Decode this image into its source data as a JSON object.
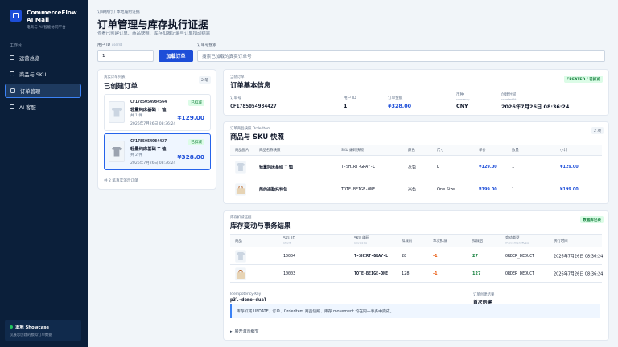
{
  "sidebar": {
    "brand_name": "CommerceFlow AI Mall",
    "brand_sub": "电商与 AI 智能协同平台",
    "section": "工作台",
    "items": [
      {
        "label": "运营总览"
      },
      {
        "label": "商品与 SKU"
      },
      {
        "label": "订单管理"
      },
      {
        "label": "AI 客服"
      }
    ],
    "showcase_title": "本地 Showcase",
    "showcase_desc": "仅展示创建的模拟订单数据"
  },
  "header": {
    "breadcrumb": "订单执行 / 本地履约证据",
    "title": "订单管理与库存执行证据",
    "subtitle": "查看已创建订单、商品快照、库存扣减记录与订单扣动结果"
  },
  "form": {
    "user_id_label": "用户 ID",
    "user_id_hint": "userId",
    "user_id_value": "1",
    "load_button": "加载订单",
    "order_no_label": "订单号搜索",
    "order_no_placeholder": "搜索已加载的真实订单号"
  },
  "orders_panel": {
    "eyebrow": "真实订单列表",
    "title": "已创建订单",
    "count": "2 笔",
    "orders": [
      {
        "no": "CF1785054984564",
        "name": "轻量纯床基础 T 恤",
        "qty": "共 1 件",
        "time": "2026年7月26日 08:36:24",
        "status": "已扣减",
        "amount": "¥129.00"
      },
      {
        "no": "CF1785054984427",
        "name": "轻量纯床基础 T 恤",
        "qty": "共 2 件",
        "time": "2026年7月26日 08:36:24",
        "status": "已扣减",
        "amount": "¥328.00"
      }
    ],
    "footer": "共 2 笔真实演示订单"
  },
  "order_info": {
    "eyebrow": "当前订单",
    "title": "订单基本信息",
    "status": "CREATED / 已扣减",
    "fields": [
      {
        "label": "订单号",
        "value": "CF1785054984427"
      },
      {
        "label": "用户 ID",
        "value": "1"
      },
      {
        "label": "订单金额",
        "value": "¥328.00"
      },
      {
        "label": "币种",
        "sub": "currency",
        "value": "CNY"
      },
      {
        "label": "创建时间",
        "sub": "createdAt",
        "value": "2026年7月26日 08:36:24"
      }
    ]
  },
  "sku_panel": {
    "eyebrow": "订单商品快照",
    "eyebrow_hint": "OrderItem",
    "title": "商品与 SKU 快照",
    "count": "2 项",
    "headers": [
      "商品图片",
      "商品名称快照",
      "SKU 编码快照",
      "颜色",
      "尺寸",
      "单价",
      "数量",
      "小计"
    ],
    "rows": [
      {
        "name": "轻量纯床基础 T 恤",
        "sku": "T-SHIRT-GRAY-L",
        "color": "灰色",
        "size": "L",
        "price": "¥129.00",
        "qty": "1",
        "subtotal": "¥129.00"
      },
      {
        "name": "简约通勤托特包",
        "sku": "TOTE-BEIGE-ONE",
        "color": "米色",
        "size": "One Size",
        "price": "¥199.00",
        "qty": "1",
        "subtotal": "¥199.00"
      }
    ]
  },
  "inv_panel": {
    "eyebrow": "库存扣减证据",
    "title": "库存变动与事务结果",
    "badge": "数据库记录",
    "headers": [
      {
        "t": "商品"
      },
      {
        "t": "SKU ID",
        "h": "skuId"
      },
      {
        "t": "SKU 编码",
        "h": "skuCode"
      },
      {
        "t": "扣减前"
      },
      {
        "t": "本次扣减"
      },
      {
        "t": "扣减后"
      },
      {
        "t": "变动类型",
        "h": "movementType"
      },
      {
        "t": "执行时间"
      }
    ],
    "rows": [
      {
        "sku_id": "10004",
        "sku_code": "T-SHIRT-GRAY-L",
        "before": "28",
        "change": "-1",
        "after": "27",
        "type": "ORDER_DEDUCT",
        "time": "2026年7月26日 08:36:24"
      },
      {
        "sku_id": "10003",
        "sku_code": "TOTE-BEIGE-ONE",
        "before": "128",
        "change": "-1",
        "after": "127",
        "type": "ORDER_DEDUCT",
        "time": "2026年7月26日 08:36:24"
      }
    ],
    "idem_label": "Idempotency-Key",
    "idem_value": "p3l-demo-dual",
    "txn_label": "订单创建结果",
    "txn_value": "首次创建",
    "note": "库存扣减 UPDATE、订单、OrderItem 商品快照、库存 movement 均在同一事务中完成。",
    "expand": "展开演示细节"
  },
  "colors": {
    "sidebar_bg": "#0b1f3a",
    "accent": "#1d4ed8",
    "success": "#15803d",
    "deduct": "#ea580c"
  }
}
